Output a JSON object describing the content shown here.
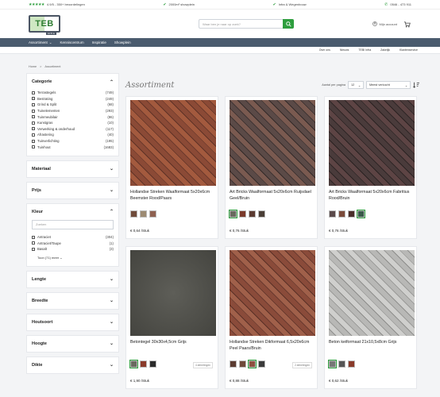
{
  "topbar": {
    "rating": "4.9/5 - 350+ beoordelingen",
    "showroom": "2000m² showplein",
    "infra": "Infra & Wegenbouw",
    "phone": "0546 - 473 911"
  },
  "header": {
    "logo_text": "TEB",
    "logo_sub": "infra",
    "search_placeholder": "Waar ben je naar op zoek?",
    "account_label": "Mijn account"
  },
  "nav": {
    "items": [
      "Assortiment",
      "Kenniscentrum",
      "Inspiratie",
      "Showplein"
    ]
  },
  "subnav": {
    "items": [
      "Over ons",
      "Nieuws",
      "TEBI Infra",
      "Zakelijk",
      "Klantenservice"
    ]
  },
  "breadcrumb": {
    "home": "Home",
    "sep": ">",
    "current": "Assortiment"
  },
  "sidebar": {
    "category": {
      "title": "Categorie",
      "items": [
        {
          "label": "Terrastegels",
          "count": "(749)"
        },
        {
          "label": "Bestrating",
          "count": "(249)"
        },
        {
          "label": "Grind & Split",
          "count": "(68)"
        },
        {
          "label": "Tuinelementen",
          "count": "(293)"
        },
        {
          "label": "Tuinmeubilair",
          "count": "(86)"
        },
        {
          "label": "Kunstgras",
          "count": "(10)"
        },
        {
          "label": "Verwerking & onderhoud",
          "count": "(117)"
        },
        {
          "label": "Afrastering",
          "count": "(40)"
        },
        {
          "label": "Tuinverlichting",
          "count": "(195)"
        },
        {
          "label": "Tuinhout",
          "count": "(1683)"
        }
      ]
    },
    "materiaal": "Materiaal",
    "prijs": "Prijs",
    "kleur": {
      "title": "Kleur",
      "search_placeholder": "Zoeken",
      "items": [
        {
          "label": "Antraciet",
          "count": "(304)"
        },
        {
          "label": "Antraciet/Taupe",
          "count": "(1)"
        },
        {
          "label": "Basalt",
          "count": "(3)"
        }
      ],
      "show_more": "Toon (71) meer"
    },
    "filters": [
      "Lengte",
      "Breedte",
      "Houtsoort",
      "Hoogte",
      "Dikte"
    ]
  },
  "main": {
    "title": "Assortiment",
    "per_page_label": "Aantal per pagina",
    "per_page_value": "12",
    "sort_value": "Meest verkocht"
  },
  "products": [
    {
      "name": "Hollandse Streken Waalformaat 5x20x6cm Beemster Rood/Paars",
      "price": "€ 0,64",
      "unit": "/Stuk",
      "more": ""
    },
    {
      "name": "Art Bricks Waalformaat 5x20x6cm Ruijsdael Geel/Bruin",
      "price": "€ 0,76",
      "unit": "/Stuk",
      "more": ""
    },
    {
      "name": "Art Bricks Waalformaat 5x20x6cm Fabritius Rood/Bruin",
      "price": "€ 0,76",
      "unit": "/Stuk",
      "more": ""
    },
    {
      "name": "Betontegel 30x30x4,5cm Grijs",
      "price": "€ 1,90",
      "unit": "/Stuk",
      "more": "4 afmetingen"
    },
    {
      "name": "Hollandse Streken Dikformaat 6,5x20x6cm Peel Paars/Bruin",
      "price": "€ 0,88",
      "unit": "/Stuk",
      "more": "2 afmetingen"
    },
    {
      "name": "Beton keiformaat 21x10,5x8cm Grijs",
      "price": "€ 0,62",
      "unit": "/Stuk",
      "more": ""
    }
  ],
  "colors": {
    "accent": "#2e9e3e",
    "nav_bg": "#4a5b6e"
  }
}
